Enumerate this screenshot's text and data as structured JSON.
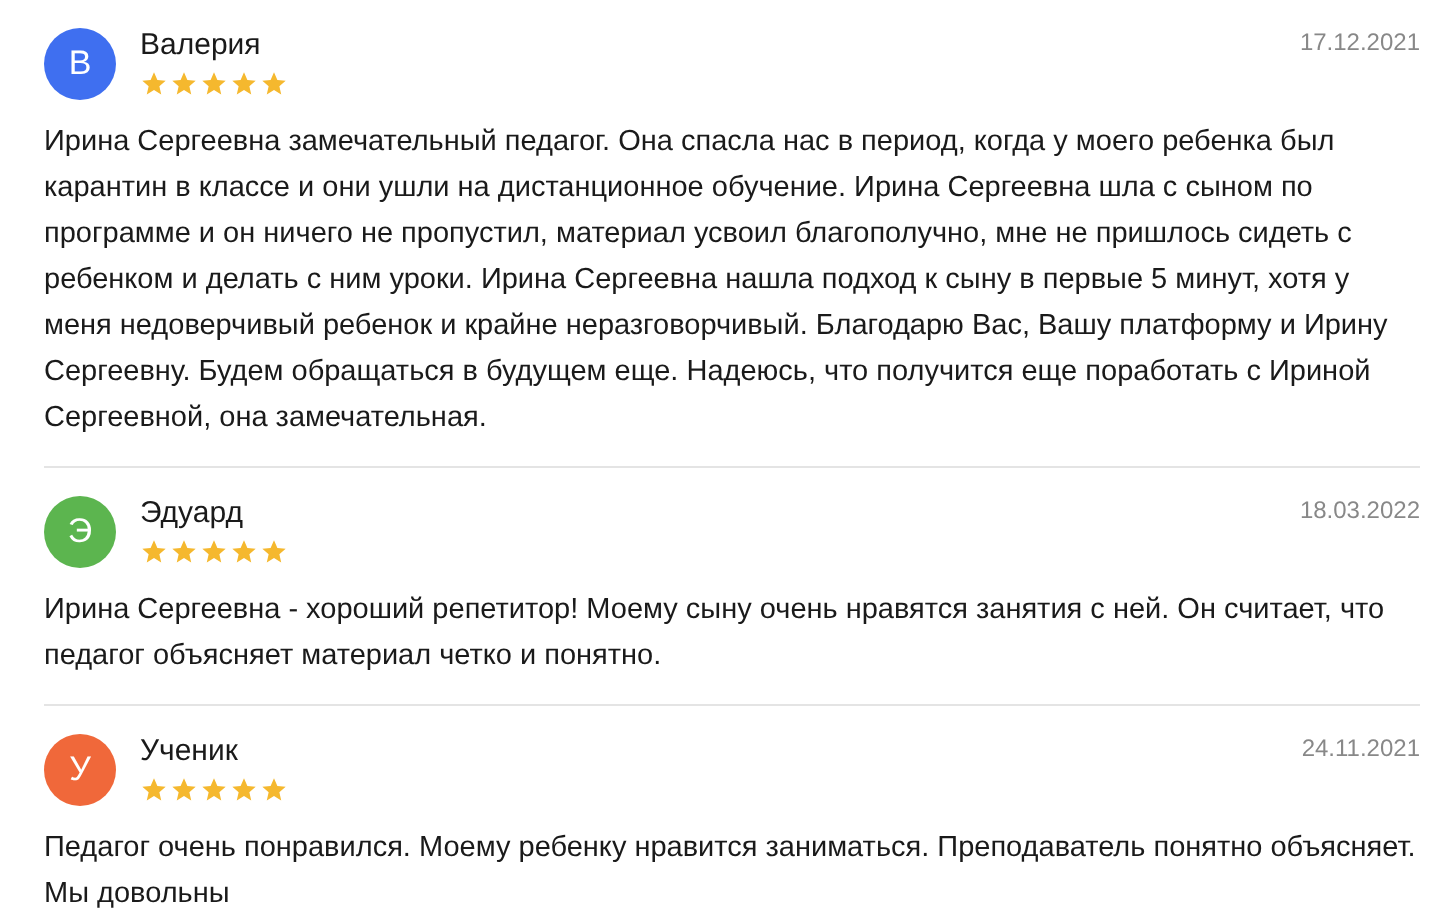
{
  "reviews": [
    {
      "initial": "В",
      "color": "#3f6ff0",
      "name": "Валерия",
      "stars": 5,
      "date": "17.12.2021",
      "text": "Ирина Сергеевна замечательный педагог. Она спасла нас в период, когда у моего ребенка был карантин в классе и они ушли на дистанционное обучение. Ирина Сергеевна шла с сыном по программе и он ничего не пропустил, материал усвоил благополучно, мне не пришлось сидеть с ребенком и делать с ним уроки. Ирина Сергеевна нашла подход к сыну в первые 5 минут, хотя у меня недоверчивый ребенок и крайне неразговорчивый. Благодарю Вас, Вашу платформу и Ирину Сергеевну. Будем обращаться в будущем еще. Надеюсь, что получится еще поработать с Ириной Сергеевной, она замечательная."
    },
    {
      "initial": "Э",
      "color": "#5cb54f",
      "name": "Эдуард",
      "stars": 5,
      "date": "18.03.2022",
      "text": "Ирина Сергеевна - хороший репетитор! Моему сыну очень нравятся занятия с ней. Он считает, что педагог объясняет материал четко и понятно."
    },
    {
      "initial": "У",
      "color": "#f0683a",
      "name": "Ученик",
      "stars": 5,
      "date": "24.11.2021",
      "text": "Педагог очень понравился. Моему ребенку нравится заниматься. Преподаватель понятно объясняет. Мы довольны"
    }
  ]
}
